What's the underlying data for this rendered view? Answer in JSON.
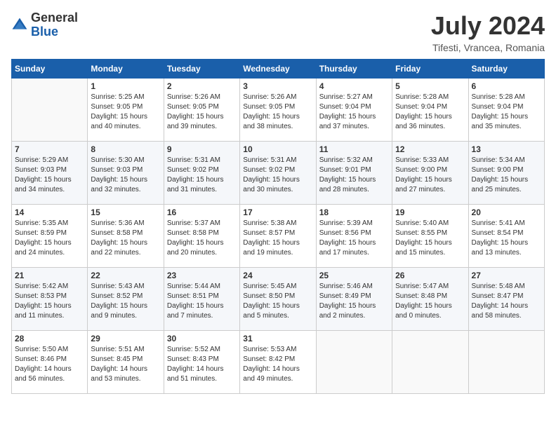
{
  "logo": {
    "general": "General",
    "blue": "Blue"
  },
  "title": "July 2024",
  "location": "Tifesti, Vrancea, Romania",
  "headers": [
    "Sunday",
    "Monday",
    "Tuesday",
    "Wednesday",
    "Thursday",
    "Friday",
    "Saturday"
  ],
  "weeks": [
    [
      {
        "day": "",
        "sunrise": "",
        "sunset": "",
        "daylight": ""
      },
      {
        "day": "1",
        "sunrise": "Sunrise: 5:25 AM",
        "sunset": "Sunset: 9:05 PM",
        "daylight": "Daylight: 15 hours and 40 minutes."
      },
      {
        "day": "2",
        "sunrise": "Sunrise: 5:26 AM",
        "sunset": "Sunset: 9:05 PM",
        "daylight": "Daylight: 15 hours and 39 minutes."
      },
      {
        "day": "3",
        "sunrise": "Sunrise: 5:26 AM",
        "sunset": "Sunset: 9:05 PM",
        "daylight": "Daylight: 15 hours and 38 minutes."
      },
      {
        "day": "4",
        "sunrise": "Sunrise: 5:27 AM",
        "sunset": "Sunset: 9:04 PM",
        "daylight": "Daylight: 15 hours and 37 minutes."
      },
      {
        "day": "5",
        "sunrise": "Sunrise: 5:28 AM",
        "sunset": "Sunset: 9:04 PM",
        "daylight": "Daylight: 15 hours and 36 minutes."
      },
      {
        "day": "6",
        "sunrise": "Sunrise: 5:28 AM",
        "sunset": "Sunset: 9:04 PM",
        "daylight": "Daylight: 15 hours and 35 minutes."
      }
    ],
    [
      {
        "day": "7",
        "sunrise": "Sunrise: 5:29 AM",
        "sunset": "Sunset: 9:03 PM",
        "daylight": "Daylight: 15 hours and 34 minutes."
      },
      {
        "day": "8",
        "sunrise": "Sunrise: 5:30 AM",
        "sunset": "Sunset: 9:03 PM",
        "daylight": "Daylight: 15 hours and 32 minutes."
      },
      {
        "day": "9",
        "sunrise": "Sunrise: 5:31 AM",
        "sunset": "Sunset: 9:02 PM",
        "daylight": "Daylight: 15 hours and 31 minutes."
      },
      {
        "day": "10",
        "sunrise": "Sunrise: 5:31 AM",
        "sunset": "Sunset: 9:02 PM",
        "daylight": "Daylight: 15 hours and 30 minutes."
      },
      {
        "day": "11",
        "sunrise": "Sunrise: 5:32 AM",
        "sunset": "Sunset: 9:01 PM",
        "daylight": "Daylight: 15 hours and 28 minutes."
      },
      {
        "day": "12",
        "sunrise": "Sunrise: 5:33 AM",
        "sunset": "Sunset: 9:00 PM",
        "daylight": "Daylight: 15 hours and 27 minutes."
      },
      {
        "day": "13",
        "sunrise": "Sunrise: 5:34 AM",
        "sunset": "Sunset: 9:00 PM",
        "daylight": "Daylight: 15 hours and 25 minutes."
      }
    ],
    [
      {
        "day": "14",
        "sunrise": "Sunrise: 5:35 AM",
        "sunset": "Sunset: 8:59 PM",
        "daylight": "Daylight: 15 hours and 24 minutes."
      },
      {
        "day": "15",
        "sunrise": "Sunrise: 5:36 AM",
        "sunset": "Sunset: 8:58 PM",
        "daylight": "Daylight: 15 hours and 22 minutes."
      },
      {
        "day": "16",
        "sunrise": "Sunrise: 5:37 AM",
        "sunset": "Sunset: 8:58 PM",
        "daylight": "Daylight: 15 hours and 20 minutes."
      },
      {
        "day": "17",
        "sunrise": "Sunrise: 5:38 AM",
        "sunset": "Sunset: 8:57 PM",
        "daylight": "Daylight: 15 hours and 19 minutes."
      },
      {
        "day": "18",
        "sunrise": "Sunrise: 5:39 AM",
        "sunset": "Sunset: 8:56 PM",
        "daylight": "Daylight: 15 hours and 17 minutes."
      },
      {
        "day": "19",
        "sunrise": "Sunrise: 5:40 AM",
        "sunset": "Sunset: 8:55 PM",
        "daylight": "Daylight: 15 hours and 15 minutes."
      },
      {
        "day": "20",
        "sunrise": "Sunrise: 5:41 AM",
        "sunset": "Sunset: 8:54 PM",
        "daylight": "Daylight: 15 hours and 13 minutes."
      }
    ],
    [
      {
        "day": "21",
        "sunrise": "Sunrise: 5:42 AM",
        "sunset": "Sunset: 8:53 PM",
        "daylight": "Daylight: 15 hours and 11 minutes."
      },
      {
        "day": "22",
        "sunrise": "Sunrise: 5:43 AM",
        "sunset": "Sunset: 8:52 PM",
        "daylight": "Daylight: 15 hours and 9 minutes."
      },
      {
        "day": "23",
        "sunrise": "Sunrise: 5:44 AM",
        "sunset": "Sunset: 8:51 PM",
        "daylight": "Daylight: 15 hours and 7 minutes."
      },
      {
        "day": "24",
        "sunrise": "Sunrise: 5:45 AM",
        "sunset": "Sunset: 8:50 PM",
        "daylight": "Daylight: 15 hours and 5 minutes."
      },
      {
        "day": "25",
        "sunrise": "Sunrise: 5:46 AM",
        "sunset": "Sunset: 8:49 PM",
        "daylight": "Daylight: 15 hours and 2 minutes."
      },
      {
        "day": "26",
        "sunrise": "Sunrise: 5:47 AM",
        "sunset": "Sunset: 8:48 PM",
        "daylight": "Daylight: 15 hours and 0 minutes."
      },
      {
        "day": "27",
        "sunrise": "Sunrise: 5:48 AM",
        "sunset": "Sunset: 8:47 PM",
        "daylight": "Daylight: 14 hours and 58 minutes."
      }
    ],
    [
      {
        "day": "28",
        "sunrise": "Sunrise: 5:50 AM",
        "sunset": "Sunset: 8:46 PM",
        "daylight": "Daylight: 14 hours and 56 minutes."
      },
      {
        "day": "29",
        "sunrise": "Sunrise: 5:51 AM",
        "sunset": "Sunset: 8:45 PM",
        "daylight": "Daylight: 14 hours and 53 minutes."
      },
      {
        "day": "30",
        "sunrise": "Sunrise: 5:52 AM",
        "sunset": "Sunset: 8:43 PM",
        "daylight": "Daylight: 14 hours and 51 minutes."
      },
      {
        "day": "31",
        "sunrise": "Sunrise: 5:53 AM",
        "sunset": "Sunset: 8:42 PM",
        "daylight": "Daylight: 14 hours and 49 minutes."
      },
      {
        "day": "",
        "sunrise": "",
        "sunset": "",
        "daylight": ""
      },
      {
        "day": "",
        "sunrise": "",
        "sunset": "",
        "daylight": ""
      },
      {
        "day": "",
        "sunrise": "",
        "sunset": "",
        "daylight": ""
      }
    ]
  ]
}
